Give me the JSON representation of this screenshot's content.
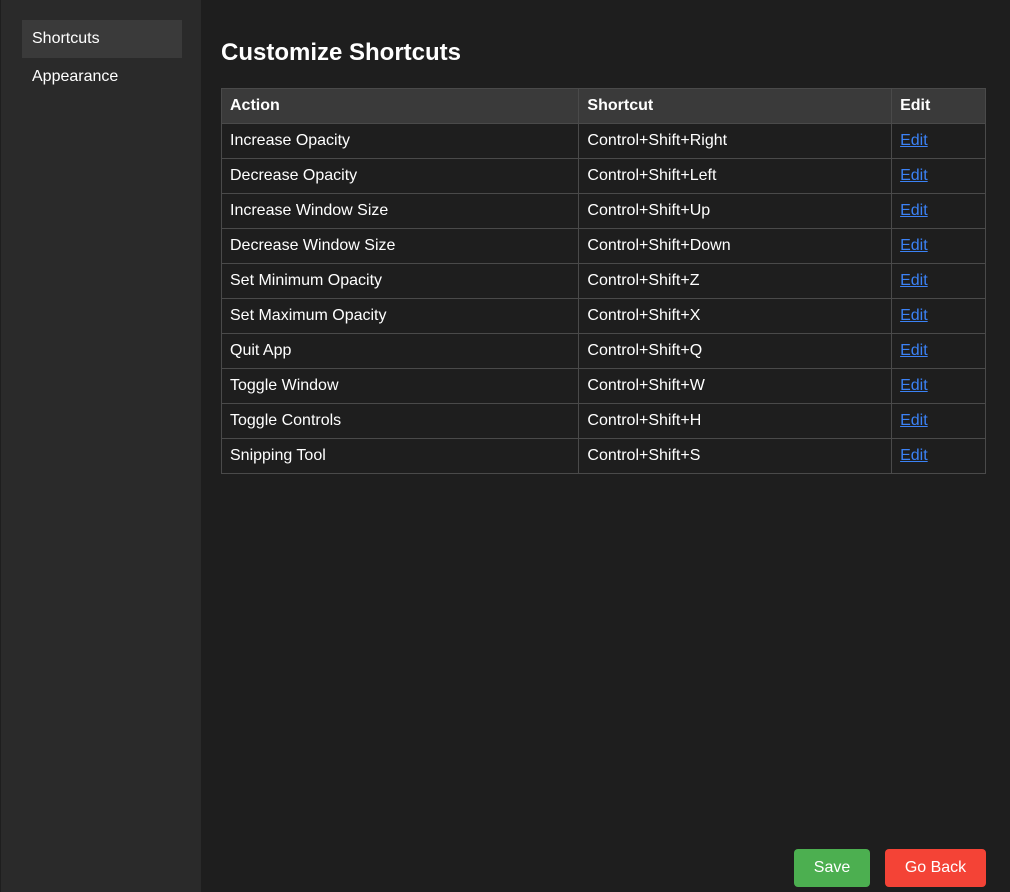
{
  "sidebar": {
    "items": [
      {
        "label": "Shortcuts",
        "active": true
      },
      {
        "label": "Appearance",
        "active": false
      }
    ]
  },
  "main": {
    "title": "Customize Shortcuts",
    "table": {
      "headers": [
        "Action",
        "Shortcut",
        "Edit"
      ],
      "rows": [
        {
          "action": "Increase Opacity",
          "shortcut": "Control+Shift+Right",
          "edit": "Edit"
        },
        {
          "action": "Decrease Opacity",
          "shortcut": "Control+Shift+Left",
          "edit": "Edit"
        },
        {
          "action": "Increase Window Size",
          "shortcut": "Control+Shift+Up",
          "edit": "Edit"
        },
        {
          "action": "Decrease Window Size",
          "shortcut": "Control+Shift+Down",
          "edit": "Edit"
        },
        {
          "action": "Set Minimum Opacity",
          "shortcut": "Control+Shift+Z",
          "edit": "Edit"
        },
        {
          "action": "Set Maximum Opacity",
          "shortcut": "Control+Shift+X",
          "edit": "Edit"
        },
        {
          "action": "Quit App",
          "shortcut": "Control+Shift+Q",
          "edit": "Edit"
        },
        {
          "action": "Toggle Window",
          "shortcut": "Control+Shift+W",
          "edit": "Edit"
        },
        {
          "action": "Toggle Controls",
          "shortcut": "Control+Shift+H",
          "edit": "Edit"
        },
        {
          "action": "Snipping Tool",
          "shortcut": "Control+Shift+S",
          "edit": "Edit"
        }
      ]
    },
    "buttons": {
      "save_label": "Save",
      "back_label": "Go Back"
    }
  },
  "colors": {
    "save": "#4caf50",
    "go_back": "#f44336",
    "link": "#3b82f6"
  }
}
